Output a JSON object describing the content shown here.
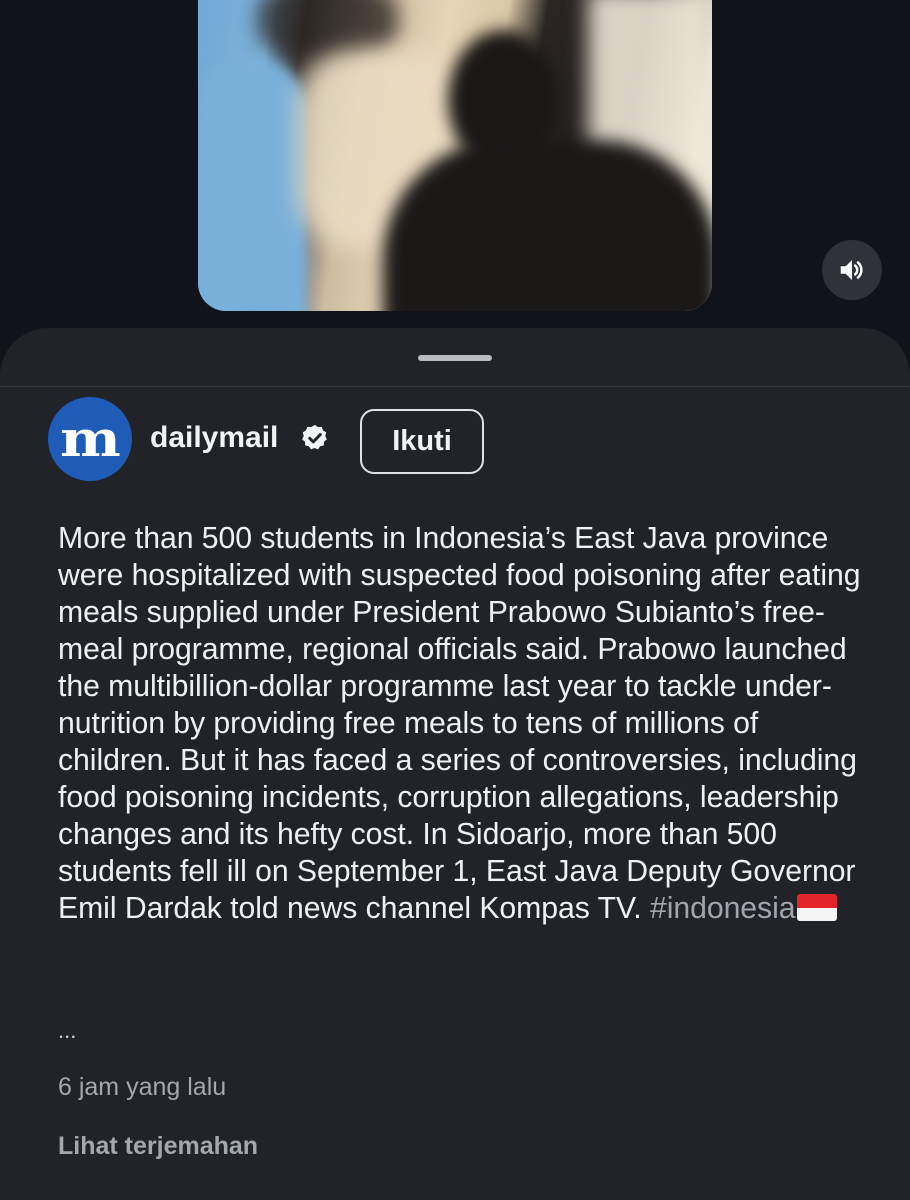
{
  "video": {
    "volume_icon": "speaker-volume-icon"
  },
  "post": {
    "account": {
      "avatar_letter": "m",
      "username": "dailymail",
      "verified_icon": "verified-badge-icon",
      "follow_label": "Ikuti"
    },
    "caption_text": "More than 500 students in Indonesia’s East Java province were hospitalized with suspected food poisoning after eating meals supplied under President Prabowo Subianto’s free-meal programme, regional officials said. Prabowo launched the multibillion-dollar programme last year to tackle under-nutrition by providing free meals to tens of millions of children. But it has faced a series of controversies, including food poisoning incidents, corruption allegations, leadership changes and its hefty cost. In Sidoarjo, more than 500 students fell ill on September 1, East Java Deputy Governor Emil Dardak told news channel Kompas TV. ",
    "hashtag": "#indonesia",
    "hashtag_flag_icon": "indonesia-flag-icon",
    "more_ellipsis": "...",
    "timestamp": "6 jam yang lalu",
    "translate_label": "Lihat terjemahan"
  },
  "colors": {
    "background": "#10141a",
    "sheet": "#212328",
    "avatar": "#1f5cb8",
    "secondary_text": "#a3a7ae"
  }
}
